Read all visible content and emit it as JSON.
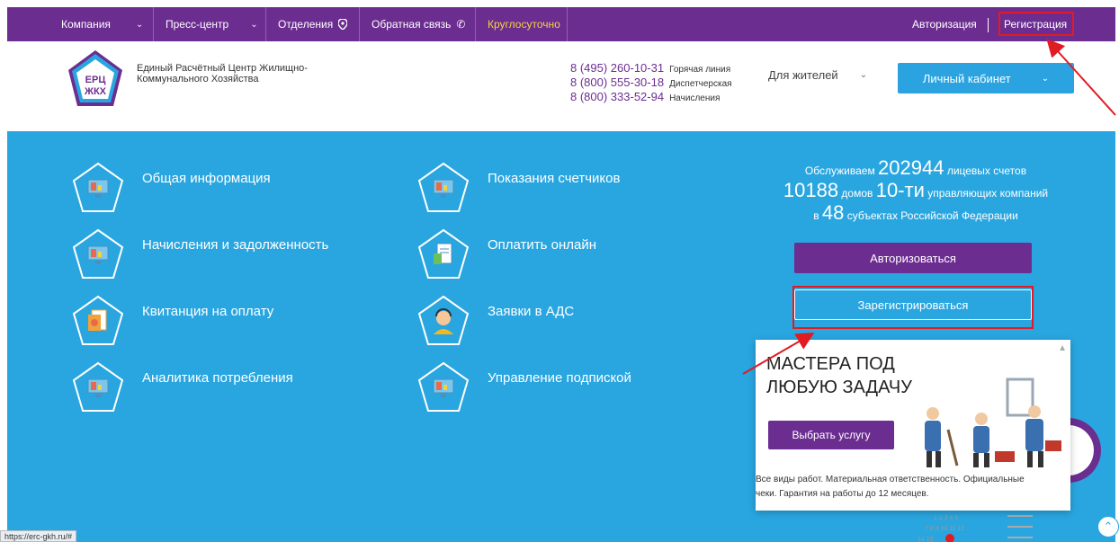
{
  "topnav": {
    "company": "Компания",
    "press": "Пресс-центр",
    "offices": "Отделения",
    "feedback": "Обратная связь",
    "allday": "Круглосуточно",
    "login": "Авторизация",
    "register": "Регистрация"
  },
  "header": {
    "logo_line1": "ЕРЦ",
    "logo_line2": "ЖКХ",
    "org_name": "Единый Расчётный Центр Жилищно-Коммунального Хозяйства",
    "phones": [
      {
        "number": "8 (495) 260-10-31",
        "label": "Горячая линия"
      },
      {
        "number": "8 (800) 555-30-18",
        "label": "Диспетчерская"
      },
      {
        "number": "8 (800) 333-52-94",
        "label": "Начисления"
      }
    ],
    "residents": "Для жителей",
    "cabinet": "Личный кабинет"
  },
  "menu": {
    "left": [
      "Общая информация",
      "Начисления и задолженность",
      "Квитанция на оплату",
      "Аналитика потребления"
    ],
    "right": [
      "Показания счетчиков",
      "Оплатить онлайн",
      "Заявки в АДС",
      "Управление подпиской"
    ]
  },
  "stats": {
    "serve": "Обслуживаем",
    "accounts": "202944",
    "accounts_lbl": "лицевых счетов",
    "houses": "10188",
    "houses_lbl": "домов",
    "companies": "10-ти",
    "companies_lbl": "управляющих компаний",
    "in": "в",
    "regions": "48",
    "regions_lbl": "субъектах Российской Федерации"
  },
  "actions": {
    "authorize": "Авторизоваться",
    "register": "Зарегистрироваться"
  },
  "ad": {
    "title": "МАСТЕРА ПОД ЛЮБУЮ ЗАДАЧУ",
    "button": "Выбрать услугу",
    "text": "Все виды работ. Материальная ответственность. Официальные чеки. Гарантия на работы до 12 месяцев."
  },
  "status_url": "https://erc-gkh.ru/#",
  "colors": {
    "purple": "#6c2d91",
    "blue": "#29a6e0",
    "red": "#e01b22",
    "yellow": "#f2d240"
  }
}
